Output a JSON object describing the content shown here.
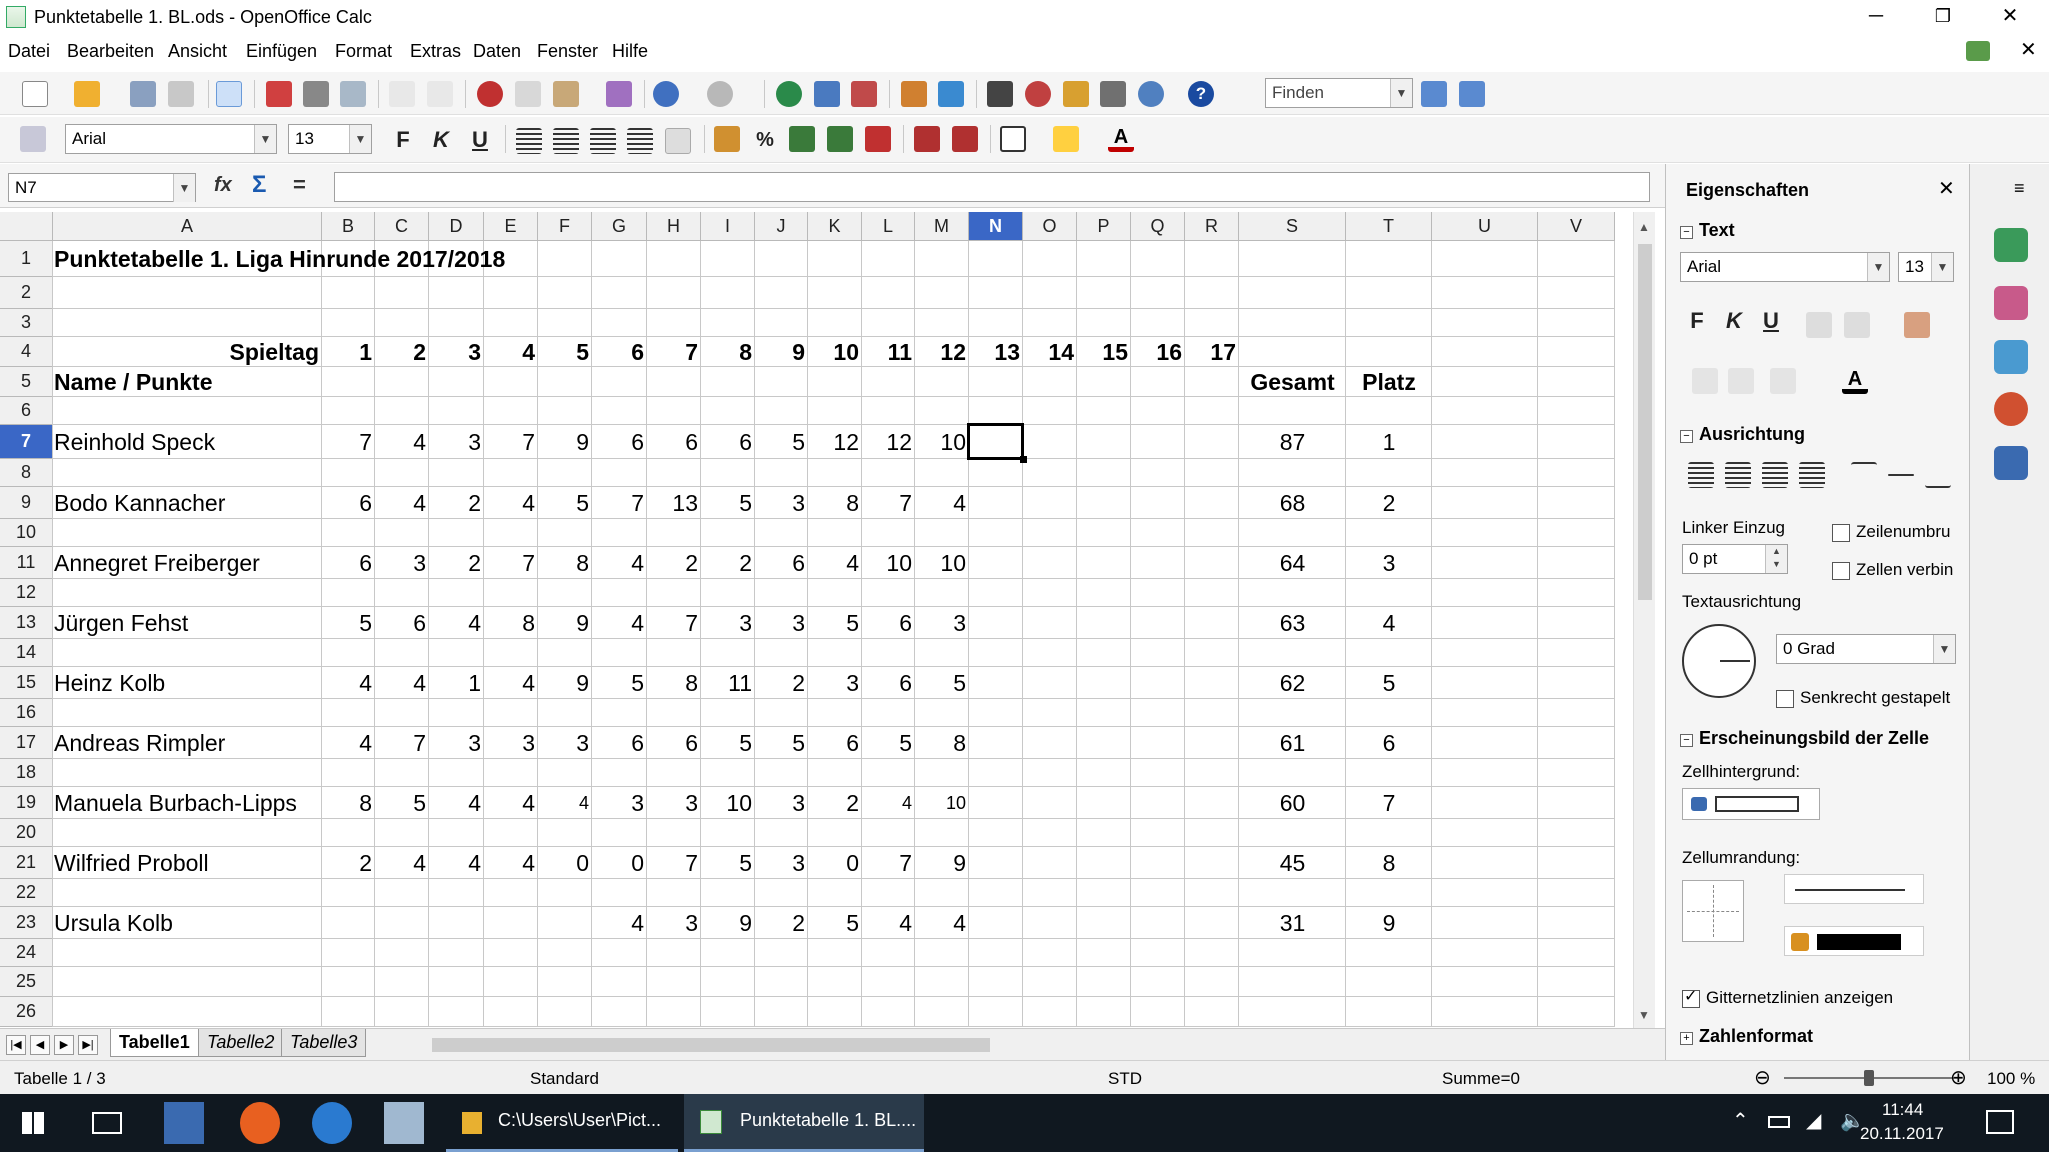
{
  "window": {
    "title": "Punktetabelle 1. BL.ods - OpenOffice Calc",
    "minimize": "─",
    "maximize": "❐",
    "close": "✕",
    "doc_close": "✕"
  },
  "menu": [
    "Datei",
    "Bearbeiten",
    "Ansicht",
    "Einfügen",
    "Format",
    "Extras",
    "Daten",
    "Fenster",
    "Hilfe"
  ],
  "toolbar": {
    "find_placeholder": "Finden",
    "font_name": "Arial",
    "font_size": "13",
    "bold": "F",
    "italic": "K",
    "underline": "U",
    "percent": "%"
  },
  "formula": {
    "namebox": "N7",
    "input": "",
    "fx": "fx",
    "sum": "Σ",
    "equals": "="
  },
  "columns": [
    "A",
    "B",
    "C",
    "D",
    "E",
    "F",
    "G",
    "H",
    "I",
    "J",
    "K",
    "L",
    "M",
    "N",
    "O",
    "P",
    "Q",
    "R",
    "S",
    "T",
    "U",
    "V"
  ],
  "selected_column": "N",
  "selected_row": 7,
  "rows": [
    "1",
    "2",
    "3",
    "4",
    "5",
    "6",
    "7",
    "8",
    "9",
    "10",
    "11",
    "12",
    "13",
    "14",
    "15",
    "16",
    "17",
    "18",
    "19",
    "20",
    "21",
    "22",
    "23",
    "24",
    "25",
    "26"
  ],
  "sheet": {
    "title": "Punktetabelle 1. Liga Hinrunde 2017/2018",
    "spieltag_label": "Spieltag",
    "spieltage": [
      "1",
      "2",
      "3",
      "4",
      "5",
      "6",
      "7",
      "8",
      "9",
      "10",
      "11",
      "12",
      "13",
      "14",
      "15",
      "16",
      "17"
    ],
    "name_header": "Name / Punkte",
    "gesamt_header": "Gesamt",
    "platz_header": "Platz",
    "players": [
      {
        "row": 7,
        "name": "Reinhold Speck",
        "points": [
          "7",
          "4",
          "3",
          "7",
          "9",
          "6",
          "6",
          "6",
          "5",
          "12",
          "12",
          "10"
        ],
        "gesamt": "87",
        "platz": "1"
      },
      {
        "row": 9,
        "name": "Bodo Kannacher",
        "points": [
          "6",
          "4",
          "2",
          "4",
          "5",
          "7",
          "13",
          "5",
          "3",
          "8",
          "7",
          "4"
        ],
        "gesamt": "68",
        "platz": "2"
      },
      {
        "row": 11,
        "name": "Annegret Freiberger",
        "points": [
          "6",
          "3",
          "2",
          "7",
          "8",
          "4",
          "2",
          "2",
          "6",
          "4",
          "10",
          "10"
        ],
        "gesamt": "64",
        "platz": "3"
      },
      {
        "row": 13,
        "name": "Jürgen Fehst",
        "points": [
          "5",
          "6",
          "4",
          "8",
          "9",
          "4",
          "7",
          "3",
          "3",
          "5",
          "6",
          "3"
        ],
        "gesamt": "63",
        "platz": "4"
      },
      {
        "row": 15,
        "name": "Heinz Kolb",
        "points": [
          "4",
          "4",
          "1",
          "4",
          "9",
          "5",
          "8",
          "11",
          "2",
          "3",
          "6",
          "5"
        ],
        "gesamt": "62",
        "platz": "5"
      },
      {
        "row": 17,
        "name": "Andreas Rimpler",
        "points": [
          "4",
          "7",
          "3",
          "3",
          "3",
          "6",
          "6",
          "5",
          "5",
          "6",
          "5",
          "8"
        ],
        "gesamt": "61",
        "platz": "6"
      },
      {
        "row": 19,
        "name": "Manuela Burbach-Lipps",
        "points": [
          "8",
          "5",
          "4",
          "4",
          "4",
          "3",
          "3",
          "10",
          "3",
          "2",
          "4",
          "10"
        ],
        "gesamt": "60",
        "platz": "7"
      },
      {
        "row": 21,
        "name": "Wilfried Proboll",
        "points": [
          "2",
          "4",
          "4",
          "4",
          "0",
          "0",
          "7",
          "5",
          "3",
          "0",
          "7",
          "9"
        ],
        "gesamt": "45",
        "platz": "8"
      },
      {
        "row": 23,
        "name": "Ursula Kolb",
        "points": [
          "",
          "",
          "",
          "",
          "",
          "4",
          "3",
          "9",
          "2",
          "5",
          "4",
          "4"
        ],
        "gesamt": "31",
        "platz": "9"
      }
    ]
  },
  "tabs": [
    "Tabelle1",
    "Tabelle2",
    "Tabelle3"
  ],
  "active_tab": "Tabelle1",
  "status": {
    "sheet": "Tabelle 1 / 3",
    "style": "Standard",
    "mode": "STD",
    "sum": "Summe=0",
    "zoom": "100 %",
    "zoom_value": 0.5
  },
  "sidebar": {
    "title": "Eigenschaften",
    "text_section": "Text",
    "font": "Arial",
    "size": "13",
    "align_section": "Ausrichtung",
    "indent_label": "Linker Einzug",
    "indent_value": "0 pt",
    "wrap_label": "Zeilenumbru",
    "merge_label": "Zellen verbin",
    "textdir_label": "Textausrichtung",
    "angle_value": "0 Grad",
    "stacked_label": "Senkrecht gestapelt",
    "appearance_section": "Erscheinungsbild der Zelle",
    "bg_label": "Zellhintergrund:",
    "border_label": "Zellumrandung:",
    "gridlines_label": "Gitternetzlinien anzeigen",
    "number_section": "Zahlenformat"
  },
  "taskbar": {
    "explorer_label": "C:\\Users\\User\\Pict...",
    "calc_label": "Punktetabelle 1. BL....",
    "time": "11:44",
    "date": "20.11.2017"
  },
  "colors": {
    "selection": "#3a67c6",
    "taskbar": "#101820"
  }
}
